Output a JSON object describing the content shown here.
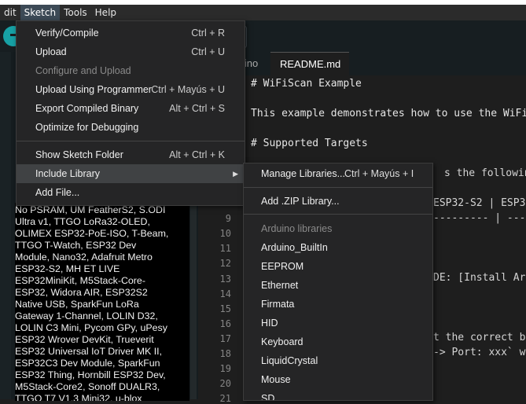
{
  "menubar": {
    "items": [
      {
        "label": "dit",
        "active": false
      },
      {
        "label": "Sketch",
        "active": true
      },
      {
        "label": "Tools",
        "active": false
      },
      {
        "label": "Help",
        "active": false
      }
    ]
  },
  "tabs": {
    "inactive": "n.ino",
    "active": "README.md"
  },
  "editor": {
    "line_numbers": [
      "9",
      "10",
      "11",
      "12",
      "13",
      "14",
      "15",
      "16",
      "17",
      "18",
      "19",
      "20",
      "21",
      "22"
    ],
    "lines": [
      {
        "text": "# WiFiScan Example"
      },
      {
        "text": "This example demonstrates how to use the WiFi"
      },
      {
        "text": "# Supported Targets"
      },
      {
        "text": "s the following"
      },
      {
        "text": "ESP32-S2 | ESP3"
      },
      {
        "text": "--------- | ----"
      },
      {
        "text": "DE: [Install Ard"
      },
      {
        "text": "t the correct bo"
      },
      {
        "text": "-> Port: xxx` wh"
      }
    ]
  },
  "sidebar": {
    "board_list": [
      "No PSRAM, UM FeatherS2, S.ODI",
      "Ultra v1, TTGO LoRa32-OLED,",
      "OLIMEX ESP32-PoE-ISO, T-Beam,",
      "TTGO T-Watch, ESP32 Dev",
      "Module, Nano32, Adafruit Metro",
      "ESP32-S2, MH ET LIVE",
      "ESP32MiniKit, M5Stack-Core-",
      "ESP32, Widora AIR, ESP32S2",
      "Native USB, SparkFun LoRa",
      "Gateway 1-Channel, LOLIN D32,",
      "LOLIN C3 Mini, Pycom GPy, uPesy",
      "ESP32 Wrover DevKit, Trueverit",
      "ESP32 Universal IoT Driver MK II,",
      "ESP32C3 Dev Module, SparkFun",
      "ESP32 Thing, Hornbill ESP32 Dev,",
      "M5Stack-Core2, Sonoff DUALR3,",
      "TTGO T7 V1.3 Mini32, u-blox"
    ]
  },
  "sketch_menu": {
    "items": [
      {
        "label": "Verify/Compile",
        "shortcut": "Ctrl + R"
      },
      {
        "label": "Upload",
        "shortcut": "Ctrl + U"
      },
      {
        "label": "Configure and Upload",
        "shortcut": ""
      },
      {
        "label": "Upload Using Programmer",
        "shortcut": "Ctrl + Mayús + U"
      },
      {
        "label": "Export Compiled Binary",
        "shortcut": "Alt + Ctrl + S"
      },
      {
        "label": "Optimize for Debugging",
        "shortcut": ""
      },
      {
        "label": "Show Sketch Folder",
        "shortcut": "Alt + Ctrl + K"
      },
      {
        "label": "Include Library",
        "shortcut": ""
      },
      {
        "label": "Add File...",
        "shortcut": ""
      }
    ]
  },
  "library_submenu": {
    "manage": {
      "label": "Manage Libraries...",
      "shortcut": "Ctrl + Mayús + I"
    },
    "add_zip": "Add .ZIP Library...",
    "section_header": "Arduino libraries",
    "libraries": [
      "Arduino_BuiltIn",
      "EEPROM",
      "Ethernet",
      "Firmata",
      "HID",
      "Keyboard",
      "LiquidCrystal",
      "Mouse",
      "SD"
    ]
  }
}
